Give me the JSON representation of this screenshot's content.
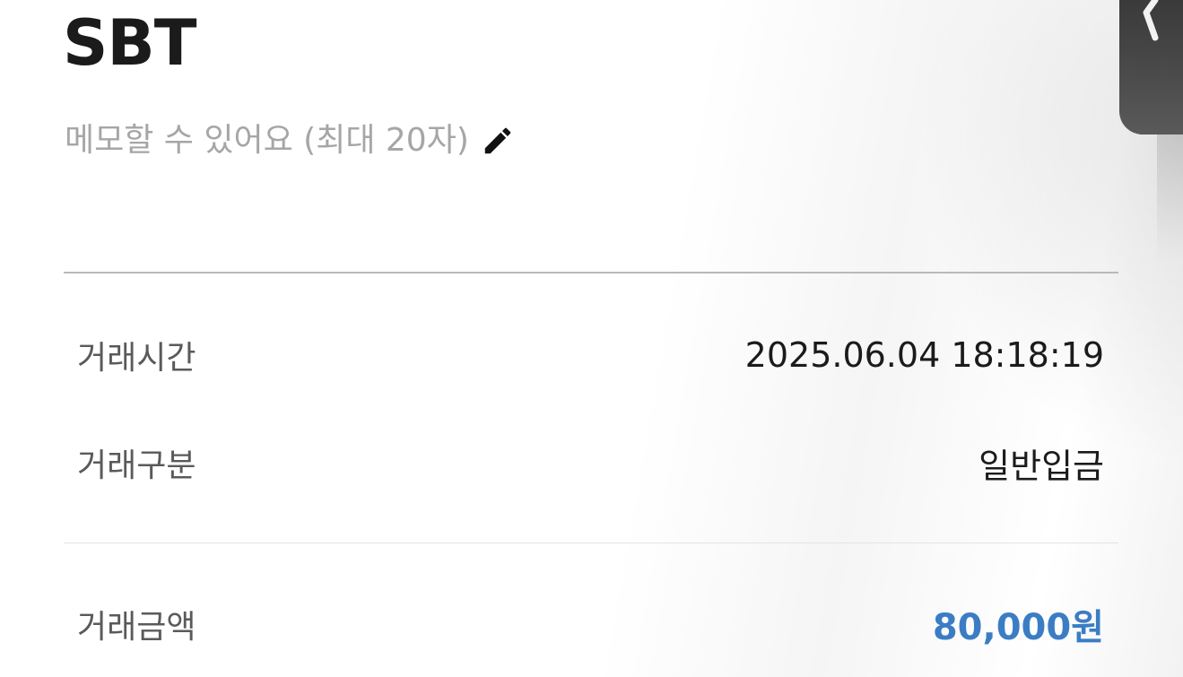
{
  "header": {
    "title": "SBT"
  },
  "memo": {
    "placeholder": "메모할 수 있어요 (최대 20자)",
    "edit_icon": "pencil-icon"
  },
  "details": [
    {
      "label": "거래시간",
      "value": "2025.06.04 18:18:19"
    },
    {
      "label": "거래구분",
      "value": "일반입금"
    },
    {
      "label": "거래금액",
      "value": "80,000원"
    }
  ],
  "side_tab": {
    "icon": "chevron-left-icon"
  },
  "colors": {
    "amount": "#3b7dc4",
    "title": "#1b1b1b",
    "memo_placeholder": "#a6a6a6",
    "label": "#5a5a5a",
    "side_tab": "#444444"
  }
}
